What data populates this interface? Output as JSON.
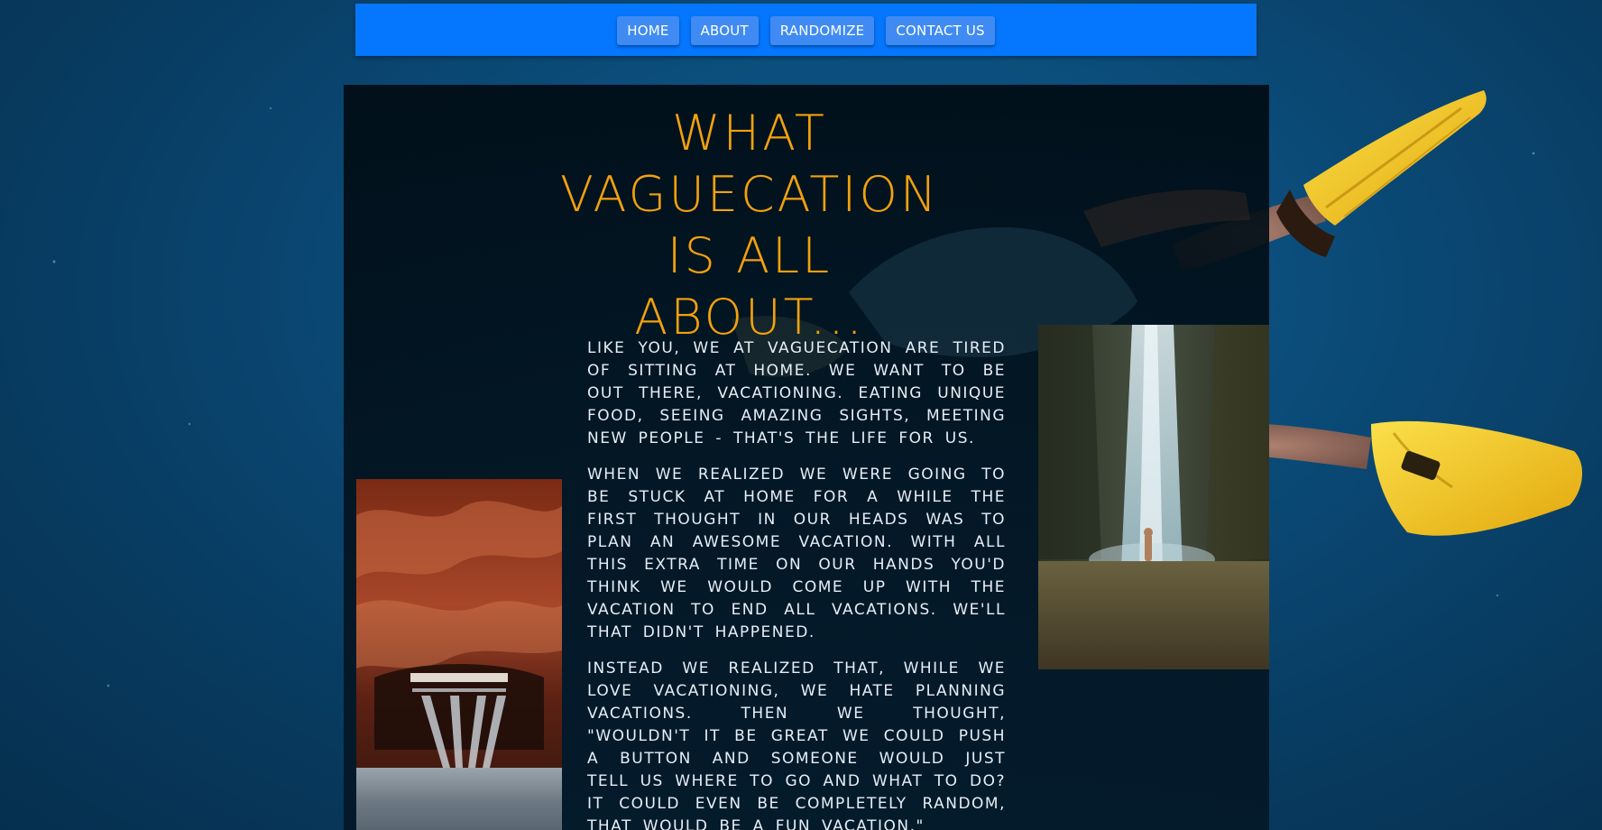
{
  "nav": {
    "items": [
      {
        "label": "HOME"
      },
      {
        "label": "ABOUT"
      },
      {
        "label": "RANDOMIZE"
      },
      {
        "label": "CONTACT US"
      }
    ]
  },
  "hero": {
    "title": "WHAT VAGUECATION IS ALL ABOUT..."
  },
  "about": {
    "paragraphs": [
      "Like you, we at Vaguecation are tired of sitting at home. We want to be out there, vacationing. Eating unique food, seeing amazing sights, meeting new people - that's the life for us.",
      "When we realized we were going to be stuck at home for a while the first thought in our heads was to plan an awesome vacation. With all this extra time on our hands you'd think we would come up with the vacation to end all vacations. We'll that didn't happened.",
      "Instead we realized that, while we love vacationing, we hate planning vacations. Then we thought, \"Wouldn't it be great we could push a button and someone would just tell us where to go and what to do? It could even be completely random, that would be a fun vacation.\""
    ]
  },
  "images": {
    "left": {
      "name": "subway-cave-escalator-photo"
    },
    "right": {
      "name": "waterfall-swimmer-photo"
    },
    "background": {
      "name": "underwater-diver-background"
    }
  },
  "colors": {
    "navbar": "#0576fe",
    "nav_button": "#3f8bf3",
    "title": "#f2a10d",
    "body_text": "#e6eef6",
    "page_background": "#0b4c7a",
    "fins": "#f5c518"
  }
}
